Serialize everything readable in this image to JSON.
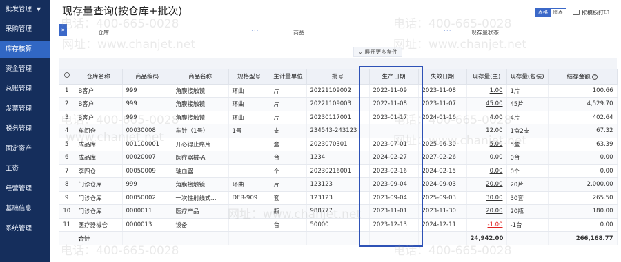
{
  "sidebar": {
    "items": [
      {
        "label": "批发管理",
        "active": false,
        "has_caret": true
      },
      {
        "label": "采购管理",
        "active": false
      },
      {
        "label": "库存核算",
        "active": true
      },
      {
        "label": "资金管理",
        "active": false
      },
      {
        "label": "总账管理",
        "active": false
      },
      {
        "label": "发票管理",
        "active": false
      },
      {
        "label": "税务管理",
        "active": false
      },
      {
        "label": "固定资产",
        "active": false
      },
      {
        "label": "工资",
        "active": false
      },
      {
        "label": "经营管理",
        "active": false
      },
      {
        "label": "基础信息",
        "active": false
      },
      {
        "label": "系统管理",
        "active": false
      }
    ]
  },
  "header": {
    "title": "现存量查询(按仓库+批次)",
    "view_table": "表格",
    "view_chart": "图表",
    "print_label": "按模板打印"
  },
  "filter": {
    "fields": [
      {
        "label": "仓库"
      },
      {
        "label": "商品"
      },
      {
        "label": "现存量状态"
      }
    ],
    "more_dots": "···",
    "expand_label": "展开更多条件"
  },
  "table": {
    "columns": [
      "仓库名称",
      "商品编码",
      "商品名称",
      "规格型号",
      "主计量单位",
      "批号",
      "生产日期",
      "失效日期",
      "现存量(主)",
      "现存量(包装)",
      "结存金额"
    ],
    "rows": [
      {
        "no": "1",
        "warehouse": "B客户",
        "code": "999",
        "name": "角膜接触镜",
        "spec": "环曲",
        "unit": "片",
        "batch": "20221109002",
        "mfg": "2022-11-09",
        "exp": "2023-11-08",
        "qty": "1.00",
        "pack": "1片",
        "amount": "100.66"
      },
      {
        "no": "2",
        "warehouse": "B客户",
        "code": "999",
        "name": "角膜接触镜",
        "spec": "环曲",
        "unit": "片",
        "batch": "20221109003",
        "mfg": "2022-11-08",
        "exp": "2023-11-07",
        "qty": "45.00",
        "pack": "45片",
        "amount": "4,529.70"
      },
      {
        "no": "3",
        "warehouse": "B客户",
        "code": "999",
        "name": "角膜接触镜",
        "spec": "环曲",
        "unit": "片",
        "batch": "20230117001",
        "mfg": "2023-01-17",
        "exp": "2024-01-16",
        "qty": "4.00",
        "pack": "4片",
        "amount": "402.64"
      },
      {
        "no": "4",
        "warehouse": "车间仓",
        "code": "00030008",
        "name": "车针（1号）",
        "spec": "1号",
        "unit": "支",
        "batch": "234543-243123",
        "mfg": "",
        "exp": "",
        "qty": "12.00",
        "pack": "1盒2支",
        "amount": "67.32"
      },
      {
        "no": "5",
        "warehouse": "成品库",
        "code": "001100001",
        "name": "开必得止痛片",
        "spec": "",
        "unit": "盒",
        "batch": "2023070301",
        "mfg": "2023-07-01",
        "exp": "2025-06-30",
        "qty": "5.00",
        "pack": "5盒",
        "amount": "63.39"
      },
      {
        "no": "6",
        "warehouse": "成品库",
        "code": "00020007",
        "name": "医疗器械-A",
        "spec": "",
        "unit": "台",
        "batch": "1234",
        "mfg": "2024-02-27",
        "exp": "2027-02-26",
        "qty": "0.00",
        "pack": "0台",
        "amount": "0.00"
      },
      {
        "no": "7",
        "warehouse": "李四仓",
        "code": "00050009",
        "name": "轴血器",
        "spec": "",
        "unit": "个",
        "batch": "20230216001",
        "mfg": "2023-02-16",
        "exp": "2024-02-15",
        "qty": "0.00",
        "pack": "0个",
        "amount": "0.00"
      },
      {
        "no": "8",
        "warehouse": "门诊仓库",
        "code": "999",
        "name": "角膜接触镜",
        "spec": "环曲",
        "unit": "片",
        "batch": "123123",
        "mfg": "2023-09-04",
        "exp": "2024-09-03",
        "qty": "20.00",
        "pack": "20片",
        "amount": "2,000.00"
      },
      {
        "no": "9",
        "warehouse": "门诊仓库",
        "code": "00050002",
        "name": "一次性射线式...",
        "spec": "DER-909",
        "unit": "套",
        "batch": "123123",
        "mfg": "2023-09-04",
        "exp": "2025-09-03",
        "qty": "30.00",
        "pack": "30套",
        "amount": "265.50"
      },
      {
        "no": "10",
        "warehouse": "门诊仓库",
        "code": "0000011",
        "name": "医疗产品",
        "spec": "",
        "unit": "瓶",
        "batch": "988777",
        "mfg": "2023-11-01",
        "exp": "2023-11-30",
        "qty": "20.00",
        "pack": "20瓶",
        "amount": "180.00"
      },
      {
        "no": "11",
        "warehouse": "医疗器械仓",
        "code": "0000013",
        "name": "设备",
        "spec": "",
        "unit": "台",
        "batch": "50000",
        "mfg": "2023-12-13",
        "exp": "2024-12-11",
        "qty": "-1.00",
        "pack": "-1台",
        "amount": "0.00"
      }
    ],
    "total": {
      "label": "合计",
      "qty": "24,942.00",
      "amount": "266,168.77"
    }
  },
  "watermarks": {
    "phone": "电话：400-665-0028",
    "site": "网址：www.chanjet.net",
    "site_short": "www.chanjet.net"
  },
  "colors": {
    "sidebar_bg": "#152e5c",
    "accent": "#3167c4",
    "highlight_border": "#2e52b6",
    "total_row_bg": "#fdf1d9",
    "negative": "#e0201f"
  }
}
